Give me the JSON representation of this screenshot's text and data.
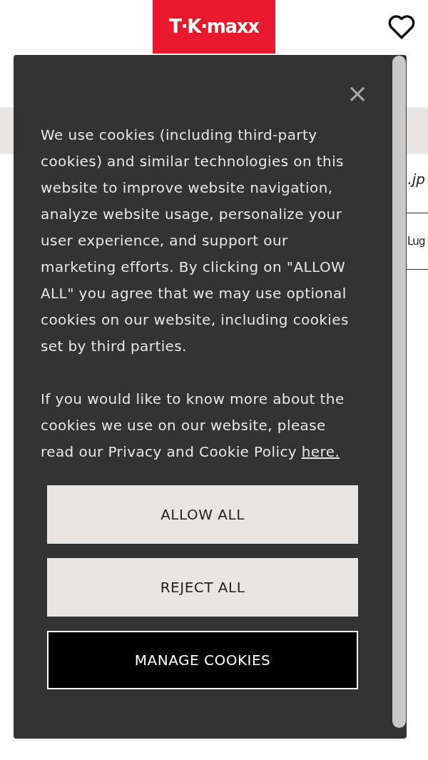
{
  "header": {
    "logo": "T·K·maxx"
  },
  "background": {
    "image_name": ".jp",
    "category": "Lug"
  },
  "cookie_dialog": {
    "close": "×",
    "paragraphs": [
      "We use cookies (including third-party cookies) and similar technologies on this website to improve website navigation, analyze website usage, personalize your user experience, and support our marketing efforts. By clicking on \"ALLOW ALL\" you agree that we may use optional cookies on our website, including cookies set by third parties.",
      "If you would like to know more about the cookies we use on our website, please read our Privacy and Cookie Policy "
    ],
    "link": "here.",
    "buttons": [
      {
        "label": "ALLOW ALL",
        "kind": "light"
      },
      {
        "label": "REJECT ALL",
        "kind": "light"
      },
      {
        "label": "MANAGE COOKIES",
        "kind": "dark"
      }
    ]
  }
}
